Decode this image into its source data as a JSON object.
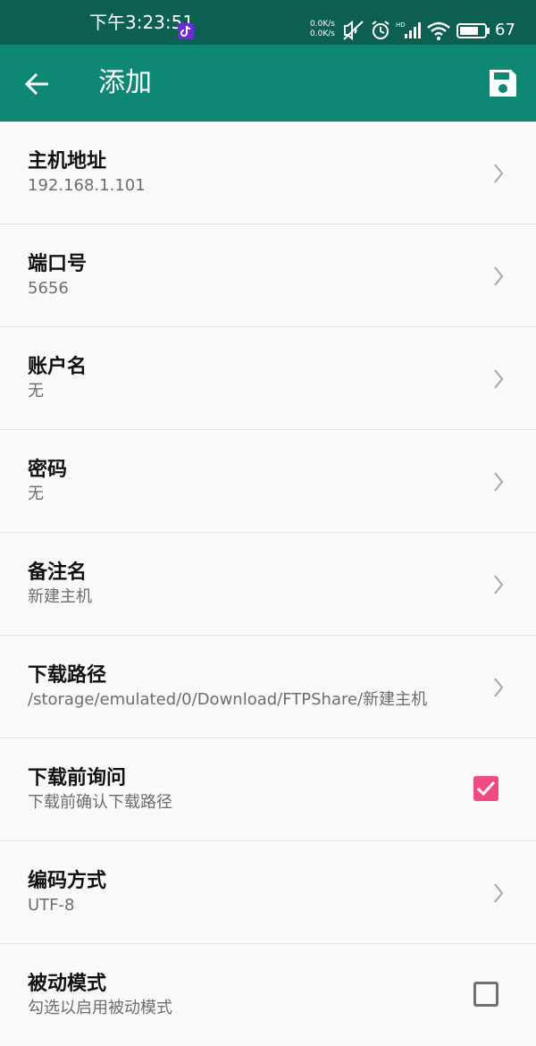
{
  "status_bar": {
    "time": "下午3:23:51",
    "net_speed_up": "0.0K/s",
    "net_speed_down": "0.0K/s",
    "battery": "67",
    "icons": [
      "tiktok-icon",
      "mute-icon",
      "alarm-icon",
      "hd-signal-icon",
      "wifi-icon",
      "battery-icon"
    ]
  },
  "app_bar": {
    "title": "添加",
    "back_icon": "arrow-left-icon",
    "save_icon": "save-icon",
    "background": "#0f8775"
  },
  "settings": [
    {
      "title": "主机地址",
      "value": "192.168.1.101",
      "control": "chevron"
    },
    {
      "title": "端口号",
      "value": "5656",
      "control": "chevron"
    },
    {
      "title": "账户名",
      "value": "无",
      "control": "chevron"
    },
    {
      "title": "密码",
      "value": "无",
      "control": "chevron"
    },
    {
      "title": "备注名",
      "value": "新建主机",
      "control": "chevron"
    },
    {
      "title": "下载路径",
      "value": "/storage/emulated/0/Download/FTPShare/新建主机",
      "control": "chevron"
    },
    {
      "title": "下载前询问",
      "value": "下载前确认下载路径",
      "control": "checkbox",
      "checked": true
    },
    {
      "title": "编码方式",
      "value": "UTF-8",
      "control": "chevron"
    },
    {
      "title": "被动模式",
      "value": "勾选以启用被动模式",
      "control": "checkbox",
      "checked": false
    }
  ],
  "colors": {
    "status_bar": "#0d5f51",
    "app_bar": "#0f8775",
    "checkbox_checked": "#f04b82"
  }
}
